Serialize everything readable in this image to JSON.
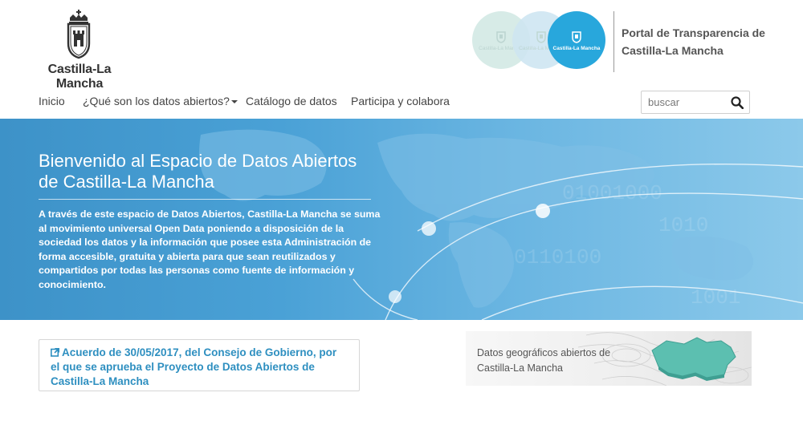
{
  "header": {
    "logo_text": "Castilla-La Mancha",
    "circles": [
      {
        "label": "Castilla-La Mancha",
        "icon": "seal-icon"
      },
      {
        "label": "Castilla-La Mancha",
        "icon": "seal-icon"
      },
      {
        "label": "Castilla-La Mancha",
        "icon": "seal-icon"
      }
    ],
    "portal_title": "Portal de Transparencia de Castilla-La Mancha"
  },
  "nav": {
    "items": [
      {
        "label": "Inicio"
      },
      {
        "label": "¿Qué son los datos abiertos?",
        "has_dropdown": true
      },
      {
        "label": "Catálogo de datos"
      },
      {
        "label": "Participa y colabora"
      }
    ],
    "search_placeholder": "buscar",
    "search_icon": "search-icon"
  },
  "hero": {
    "title": "Bienvenido al Espacio de Datos Abiertos de Castilla-La Mancha",
    "text": "A través de este espacio de Datos Abiertos, Castilla-La Mancha se suma al movimiento universal Open Data poniendo a disposición de la sociedad los datos y la información que posee esta Administración de forma accesible, gratuita y abierta para que sean reutilizados y compartidos por todas las personas como fuente de información y conocimiento."
  },
  "agreement": {
    "icon": "external-link-icon",
    "text": "Acuerdo de 30/05/2017, del Consejo de Gobierno, por el que se aprueba el Proyecto de Datos Abiertos de Castilla-La Mancha"
  },
  "geo_banner": {
    "text": "Datos geográficos abiertos de Castilla-La Mancha"
  },
  "colors": {
    "accent": "#28a7dc",
    "link": "#2e8fc0",
    "hero_blue": "#4aa1d6",
    "map_green": "#5cbfb0"
  }
}
